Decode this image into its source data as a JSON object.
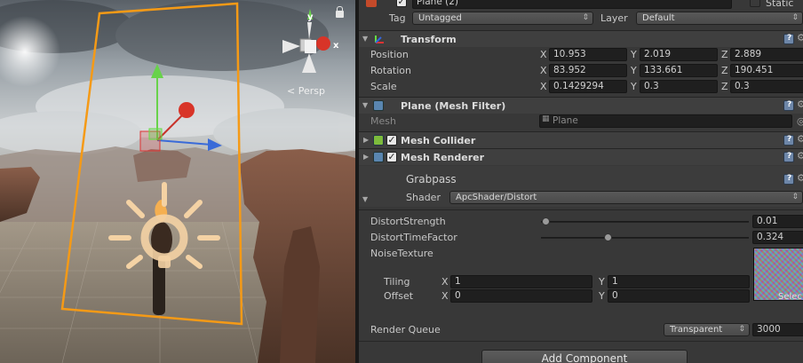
{
  "scene": {
    "persp_label": "Persp",
    "gizmo_y": "y",
    "gizmo_x": "x"
  },
  "object": {
    "name": "Plane (2)",
    "static_label": "Static",
    "tag_label": "Tag",
    "tag_value": "Untagged",
    "layer_label": "Layer",
    "layer_value": "Default"
  },
  "transform": {
    "title": "Transform",
    "position": {
      "label": "Position",
      "x": "10.953",
      "y": "2.019",
      "z": "2.889"
    },
    "rotation": {
      "label": "Rotation",
      "x": "83.952",
      "y": "133.661",
      "z": "190.451"
    },
    "scale": {
      "label": "Scale",
      "x": "0.1429294",
      "y": "0.3",
      "z": "0.3"
    }
  },
  "axes": {
    "x": "X",
    "y": "Y",
    "z": "Z"
  },
  "mesh_filter": {
    "title": "Plane (Mesh Filter)",
    "mesh_label": "Mesh",
    "mesh_value": "Plane"
  },
  "mesh_collider": {
    "title": "Mesh Collider"
  },
  "mesh_renderer": {
    "title": "Mesh Renderer"
  },
  "material": {
    "name": "Grabpass",
    "shader_label": "Shader",
    "shader_value": "ApcShader/Distort",
    "distort_strength": {
      "label": "DistortStrength",
      "value": "0.01",
      "fraction": 0.02
    },
    "distort_time_factor": {
      "label": "DistortTimeFactor",
      "value": "0.324",
      "fraction": 0.32
    },
    "noise_texture": {
      "label": "NoiseTexture",
      "select": "Selec"
    },
    "tiling": {
      "label": "Tiling",
      "x": "1",
      "y": "1"
    },
    "offset": {
      "label": "Offset",
      "x": "0",
      "y": "0"
    },
    "render_queue": {
      "label": "Render Queue",
      "mode": "Transparent",
      "value": "3000"
    }
  },
  "add_component": "Add Component"
}
